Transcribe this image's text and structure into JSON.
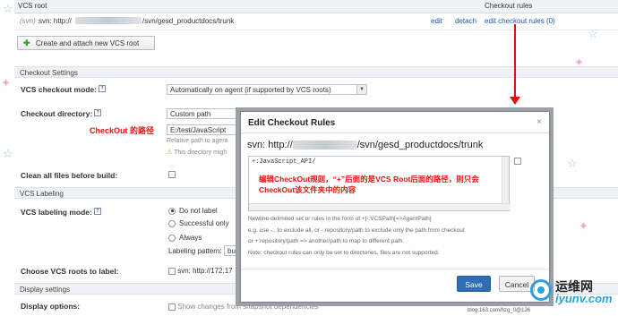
{
  "vcs_root_table": {
    "header": "VCS root",
    "header_rules": "Checkout rules",
    "row_prefix": "(svn)",
    "row_protocol": "svn: http://",
    "row_path": "/svn/gesd_productdocs/trunk",
    "edit": "edit",
    "detach": "detach",
    "edit_rules": "edit checkout rules (0)",
    "create_button": "Create and attach new VCS root"
  },
  "checkout_settings": {
    "section": "Checkout Settings",
    "mode_label": "VCS checkout mode:",
    "mode_value": "Automatically on agent (if supported by VCS roots)",
    "dir_label": "Checkout directory:",
    "dir_select": "Custom path",
    "dir_value": "E:/test/JavaScript",
    "dir_hint": "Relative path to agent",
    "dir_warning": "This directory migh",
    "annotation": "CheckOut 的路径",
    "clean_label": "Clean all files before build:"
  },
  "vcs_labeling": {
    "section": "VCS Labeling",
    "mode_label": "VCS labeling mode:",
    "options": [
      "Do not label",
      "Successful only",
      "Always"
    ],
    "pattern_label": "Labeling pattern:",
    "pattern_value": "bu",
    "roots_label": "Choose VCS roots to label:",
    "root_item": "svn: http://172.17"
  },
  "display_settings": {
    "section": "Display settings",
    "options_label": "Display options:",
    "options_value": "Show changes from snapshot dependencies"
  },
  "dialog": {
    "title": "Edit Checkout Rules",
    "close": "×",
    "vcs_protocol": "svn: http://",
    "vcs_path": "/svn/gesd_productdocs/trunk",
    "rule_text": "+:JavaScript_API/",
    "annotation": "编辑CheckOut规则，“+”后面的是VCS Root后面的路径，则只会CheckOut该文件夹中的内容",
    "help1": "Newline-delimited set or rules in the form of +|-:VCSPath[=>AgentPath]",
    "help2": "e.g. use -:. to exclude all, or -:repository/path to exclude only the path from checkout",
    "help3": "or +:repository/path => another/path to map to different path.",
    "help4": "Note: checkout rules can only be set to directories, files are not supported.",
    "save": "Save",
    "cancel": "Cancel"
  },
  "watermark": {
    "brand_cn": "运维网",
    "brand_en": "iyunv.com",
    "url": "blog.163.com/hzg_0@126"
  },
  "colors": {
    "accent": "#2f6db5",
    "annotation": "#e3130f",
    "arrow": "#d91212"
  }
}
